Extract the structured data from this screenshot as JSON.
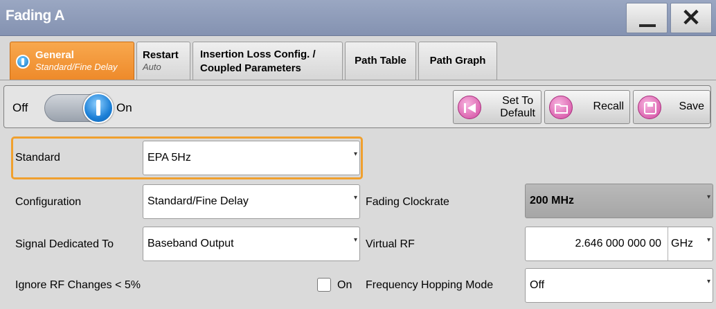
{
  "window": {
    "title": "Fading A",
    "minimize_label": "—",
    "close_label": "✕"
  },
  "tabs": [
    {
      "label": "General",
      "sub": "Standard/Fine Delay"
    },
    {
      "label": "Restart",
      "sub": "Auto"
    },
    {
      "label_line1": "Insertion Loss Config. /",
      "label_line2": "Coupled Parameters"
    },
    {
      "label": "Path Table"
    },
    {
      "label": "Path Graph"
    }
  ],
  "toolbar": {
    "off_label": "Off",
    "on_label": "On",
    "state_on": true,
    "set_default_line1": "Set To",
    "set_default_line2": "Default",
    "recall_label": "Recall",
    "save_label": "Save"
  },
  "form": {
    "standard": {
      "label": "Standard",
      "value": "EPA  5Hz"
    },
    "configuration": {
      "label": "Configuration",
      "value": "Standard/Fine Delay"
    },
    "fading_clockrate": {
      "label": "Fading Clockrate",
      "value": "200 MHz"
    },
    "signal_dedicated_to": {
      "label": "Signal Dedicated To",
      "value": "Baseband Output"
    },
    "virtual_rf": {
      "label": "Virtual RF",
      "value": "2.646 000 000 00",
      "unit": "GHz"
    },
    "ignore_rf": {
      "label": "Ignore RF Changes < 5%",
      "checkbox_label": "On",
      "checked": false
    },
    "hopping_mode": {
      "label": "Frequency Hopping Mode",
      "value": "Off"
    }
  },
  "colors": {
    "accent": "#f0a02e",
    "title_bar": "#8f9cb9",
    "toggle_knob": "#1b7fd6",
    "action_icon": "#d1479e"
  }
}
